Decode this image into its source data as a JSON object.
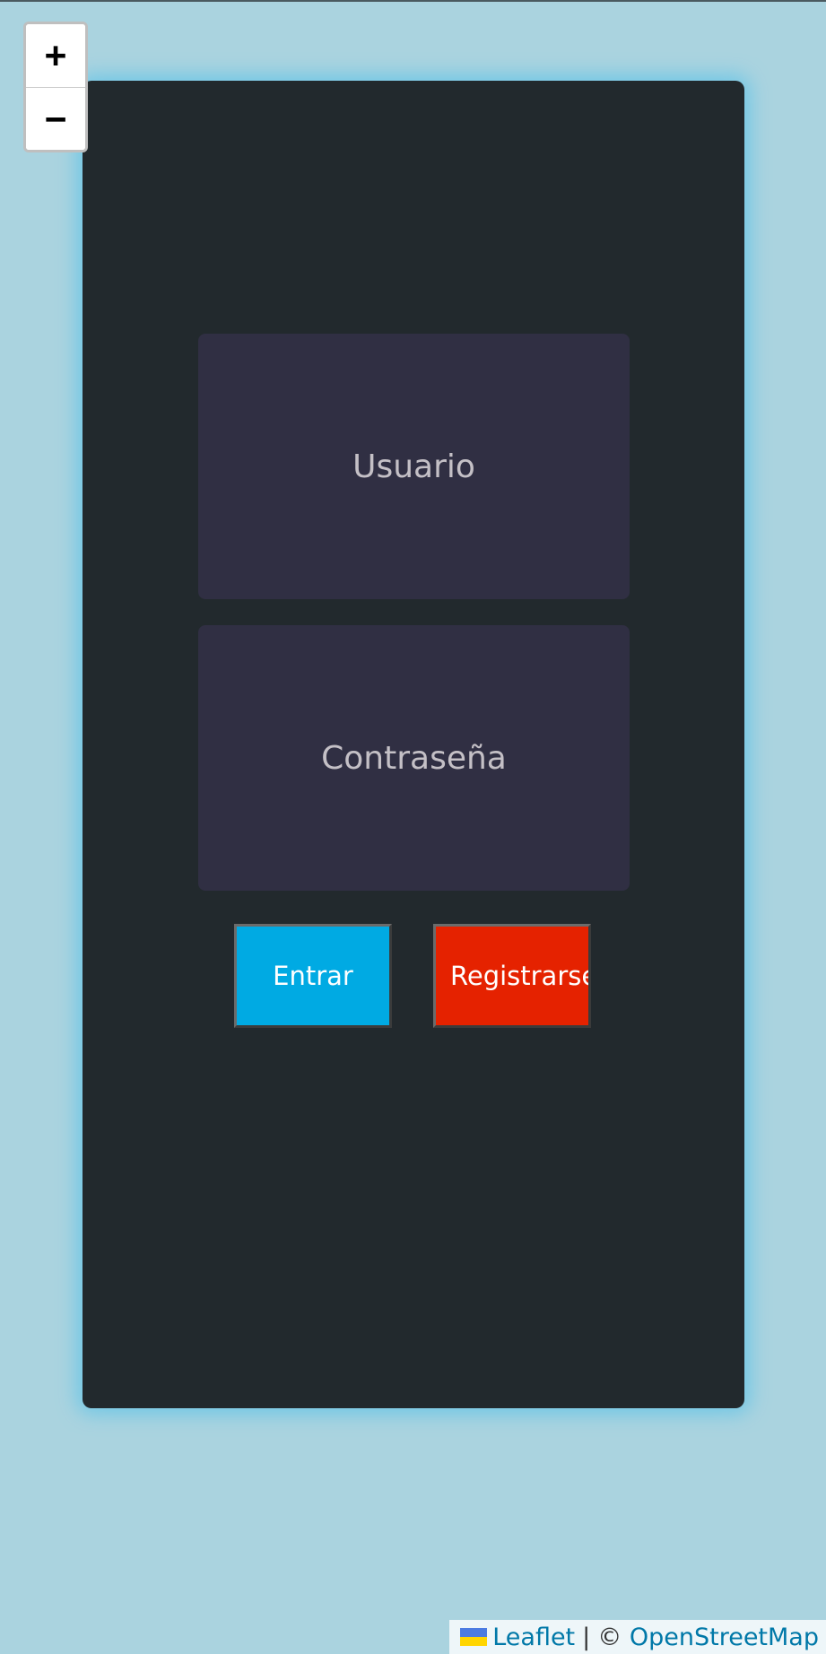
{
  "map": {
    "zoom_in_label": "+",
    "zoom_out_label": "−",
    "background_color": "#aad3df"
  },
  "login": {
    "username_placeholder": "Usuario",
    "password_placeholder": "Contraseña",
    "enter_label": "Entrar",
    "register_label": "Registrarse",
    "enter_color": "#00aae3",
    "register_color": "#e52200",
    "panel_color": "#22292d",
    "field_color": "#302f43"
  },
  "attribution": {
    "leaflet_label": "Leaflet",
    "separator": "|",
    "copyright": "©",
    "osm_label": "OpenStreetMap",
    "flag_icon": "ukraine-flag-icon"
  }
}
